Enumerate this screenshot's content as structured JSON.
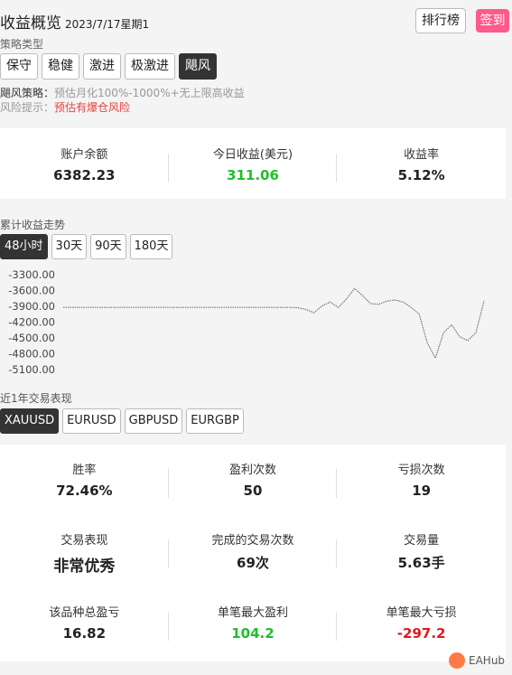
{
  "header": {
    "title": "收益概览",
    "date": "2023/7/17星期1",
    "rank_label": "排行榜",
    "signin_label": "签到"
  },
  "strategy": {
    "label": "策略类型",
    "options": [
      "保守",
      "稳健",
      "激进",
      "极激进",
      "飓风"
    ],
    "active_index": 4,
    "desc_key": "飓风策略：",
    "desc_value": "预估月化100%-1000%+无上限高收益",
    "risk_key": "风险提示：",
    "risk_value": "预估有爆仓风险"
  },
  "account": {
    "balance_label": "账户余额",
    "balance": "6382.23",
    "today_label": "今日收益(美元)",
    "today": "311.06",
    "rate_label": "收益率",
    "rate": "5.12%"
  },
  "trend": {
    "label": "累计收益走势",
    "periods": [
      "48小时",
      "30天",
      "90天",
      "180天"
    ],
    "active_index": 0
  },
  "chart_data": {
    "type": "line",
    "ylim": [
      -5100,
      -3300
    ],
    "yticks": [
      "-3300.00",
      "-3600.00",
      "-3900.00",
      "-4200.00",
      "-4500.00",
      "-4800.00",
      "-5100.00"
    ],
    "series": [
      {
        "values": [
          -3920,
          -3920,
          -3920,
          -3920,
          -3920,
          -3920,
          -3920,
          -3920,
          -3920,
          -3920,
          -3920,
          -3920,
          -3920,
          -3920,
          -3920,
          -3920,
          -3920,
          -3920,
          -3920,
          -3920,
          -3920,
          -3920,
          -3920,
          -3920,
          -3920,
          -3920,
          -3920,
          -3920,
          -3920,
          -3925,
          -3960,
          -4020,
          -3890,
          -3820,
          -3920,
          -3760,
          -3560,
          -3700,
          -3850,
          -3860,
          -3800,
          -3780,
          -3820,
          -3920,
          -4050,
          -4600,
          -4880,
          -4400,
          -4250,
          -4480,
          -4550,
          -4400,
          -3800
        ]
      }
    ]
  },
  "symbols": {
    "label": "近1年交易表现",
    "options": [
      "XAUUSD",
      "EURUSD",
      "GBPUSD",
      "EURGBP"
    ],
    "active_index": 0
  },
  "performance": {
    "winrate_label": "胜率",
    "winrate": "72.46%",
    "wins_label": "盈利次数",
    "wins": "50",
    "losses_label": "亏损次数",
    "losses": "19",
    "perf_label": "交易表现",
    "perf": "非常优秀",
    "trades_label": "完成的交易次数",
    "trades": "69次",
    "volume_label": "交易量",
    "volume": "5.63手",
    "total_label": "该品种总盈亏",
    "total": "16.82",
    "maxwin_label": "单笔最大盈利",
    "maxwin": "104.2",
    "maxloss_label": "单笔最大亏损",
    "maxloss": "-297.2"
  },
  "brand": {
    "name": "EAHub"
  },
  "colors": {
    "profit": "#1ec02b",
    "loss": "#e5171f",
    "accent": "#ff5a8a",
    "risk": "#e84040"
  }
}
